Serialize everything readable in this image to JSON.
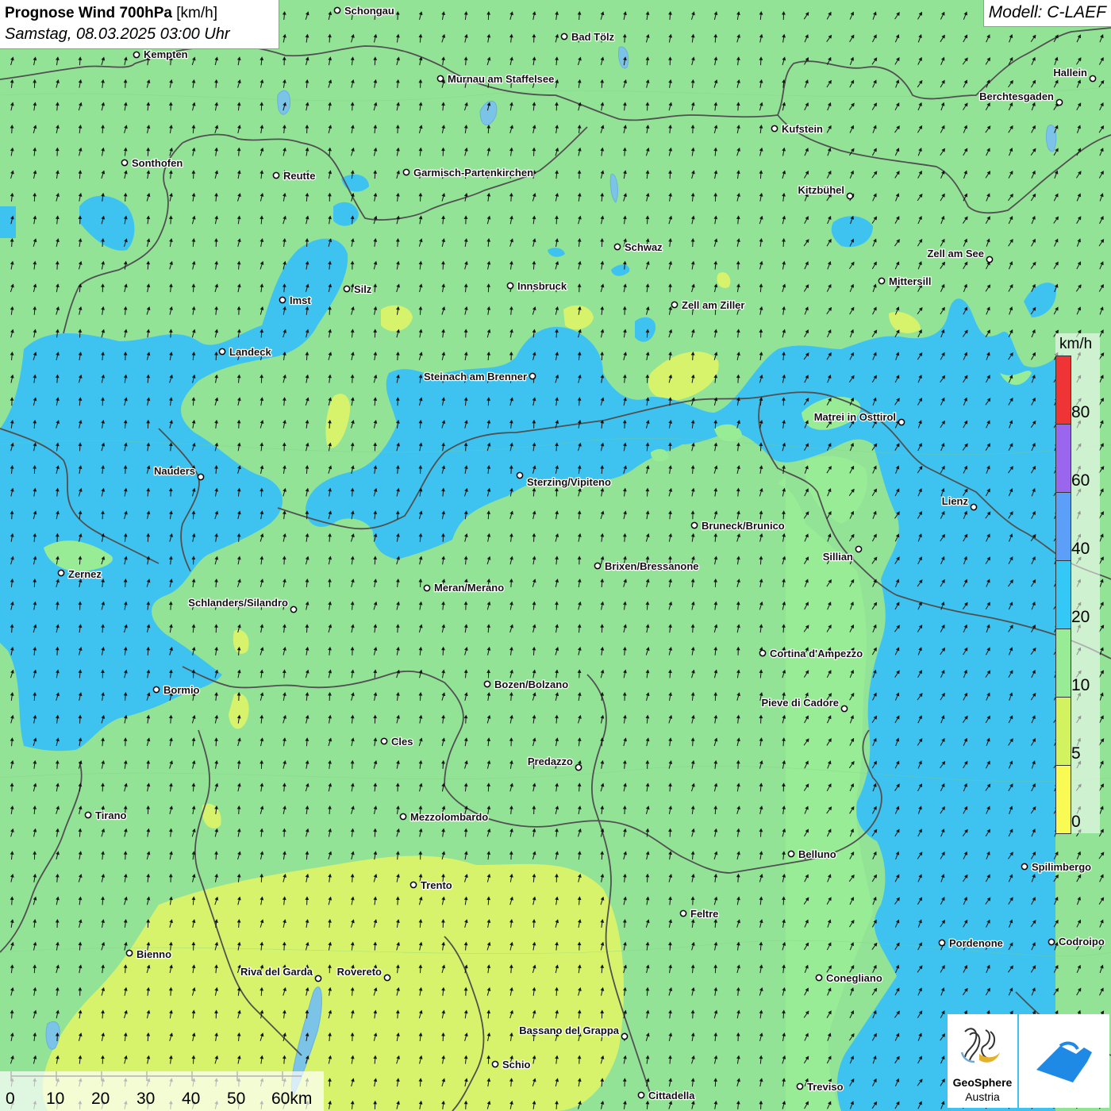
{
  "header": {
    "title_bold": "Prognose Wind 700hPa",
    "title_unit": "[km/h]",
    "datetime": "Samstag, 08.03.2025 03:00 Uhr",
    "model": "Modell: C-LAEF"
  },
  "legend": {
    "unit": "km/h",
    "labels": [
      "80",
      "60",
      "40",
      "20",
      "10",
      "5",
      "0"
    ],
    "bands": [
      {
        "from": 0,
        "to": 5,
        "color": "#fafa55"
      },
      {
        "from": 5,
        "to": 10,
        "color": "#d2f25f"
      },
      {
        "from": 10,
        "to": 20,
        "color": "#98ec96"
      },
      {
        "from": 20,
        "to": 40,
        "color": "#33c8f5"
      },
      {
        "from": 40,
        "to": 60,
        "color": "#5c9ff8"
      },
      {
        "from": 60,
        "to": 80,
        "color": "#9a66ee"
      },
      {
        "from": 80,
        "to": 100,
        "color": "#ee3434"
      }
    ]
  },
  "scale_bar": {
    "labels": [
      "0",
      "10",
      "20",
      "30",
      "40",
      "50",
      "60km"
    ]
  },
  "logos": {
    "geosphere_name": "GeoSphere",
    "geosphere_sub": "Austria"
  },
  "colors": {
    "background": "#93e397",
    "wind_zone_blue": "#3ec3f0",
    "calm_zone_yellow": "#d7f36c",
    "border": "#555555",
    "arrow": "#111111"
  },
  "wind": {
    "direction": "from south-southwest (arrows point north-northeast)"
  },
  "cities": [
    "Schongau",
    "Bad Tölz",
    "Kempten",
    "Murnau am Staffelsee",
    "Hallein",
    "Berchtesgaden",
    "Kufstein",
    "Sonthofen",
    "Reutte",
    "Garmisch-Partenkirchen",
    "Kitzbühel",
    "Schwaz",
    "Zell am See",
    "Innsbruck",
    "Silz",
    "Imst",
    "Mittersill",
    "Zell am Ziller",
    "Landeck",
    "Steinach am Brenner",
    "Matrei in Osttirol",
    "Nauders",
    "Sterzing/Vipiteno",
    "Lienz",
    "Bruneck/Brunico",
    "Sillian",
    "Zernez",
    "Brixen/Bressanone",
    "Meran/Merano",
    "Schlanders/Silandro",
    "Cortina d'Ampezzo",
    "Bozen/Bolzano",
    "Bormio",
    "Pieve di Cadore",
    "Cles",
    "Predazzo",
    "Tirano",
    "Mezzolombardo",
    "Belluno",
    "Spilimbergo",
    "Trento",
    "Feltre",
    "Pordenone",
    "Codroipo",
    "Bienno",
    "Riva del Garda",
    "Rovereto",
    "Conegliano",
    "Bassano del Grappa",
    "Schio",
    "Treviso",
    "Cittadella"
  ]
}
